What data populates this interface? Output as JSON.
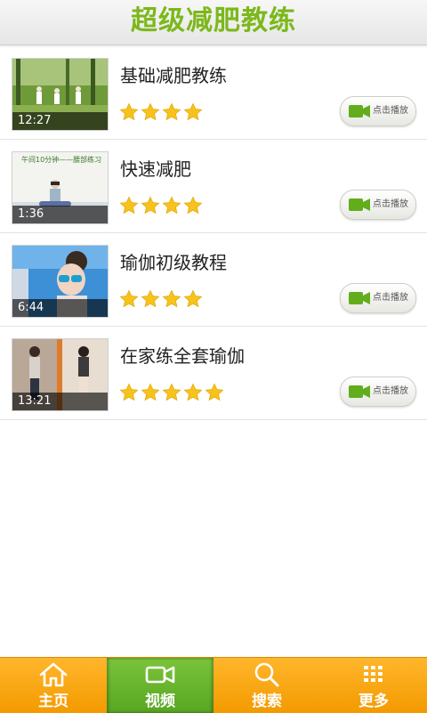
{
  "header": {
    "title": "超级减肥教练"
  },
  "colors": {
    "brand_green": "#7cb81b",
    "tab_orange": "#f7a20c",
    "tab_active_green": "#64ae2b",
    "star_yellow": "#f7c21b"
  },
  "play_label": "点击播放",
  "videos": [
    {
      "title": "基础减肥教练",
      "duration": "12:27",
      "rating": 4,
      "max_rating": 5
    },
    {
      "title": "快速减肥",
      "duration": "1:36",
      "rating": 4,
      "max_rating": 5,
      "thumb_caption": "午间10分钟——腰部练习"
    },
    {
      "title": "瑜伽初级教程",
      "duration": "6:44",
      "rating": 4,
      "max_rating": 5
    },
    {
      "title": "在家练全套瑜伽",
      "duration": "13:21",
      "rating": 5,
      "max_rating": 5
    }
  ],
  "tabs": [
    {
      "label": "主页",
      "icon": "home-icon",
      "active": false
    },
    {
      "label": "视频",
      "icon": "video-camera-icon",
      "active": true
    },
    {
      "label": "搜索",
      "icon": "search-icon",
      "active": false
    },
    {
      "label": "更多",
      "icon": "more-grid-icon",
      "active": false
    }
  ]
}
